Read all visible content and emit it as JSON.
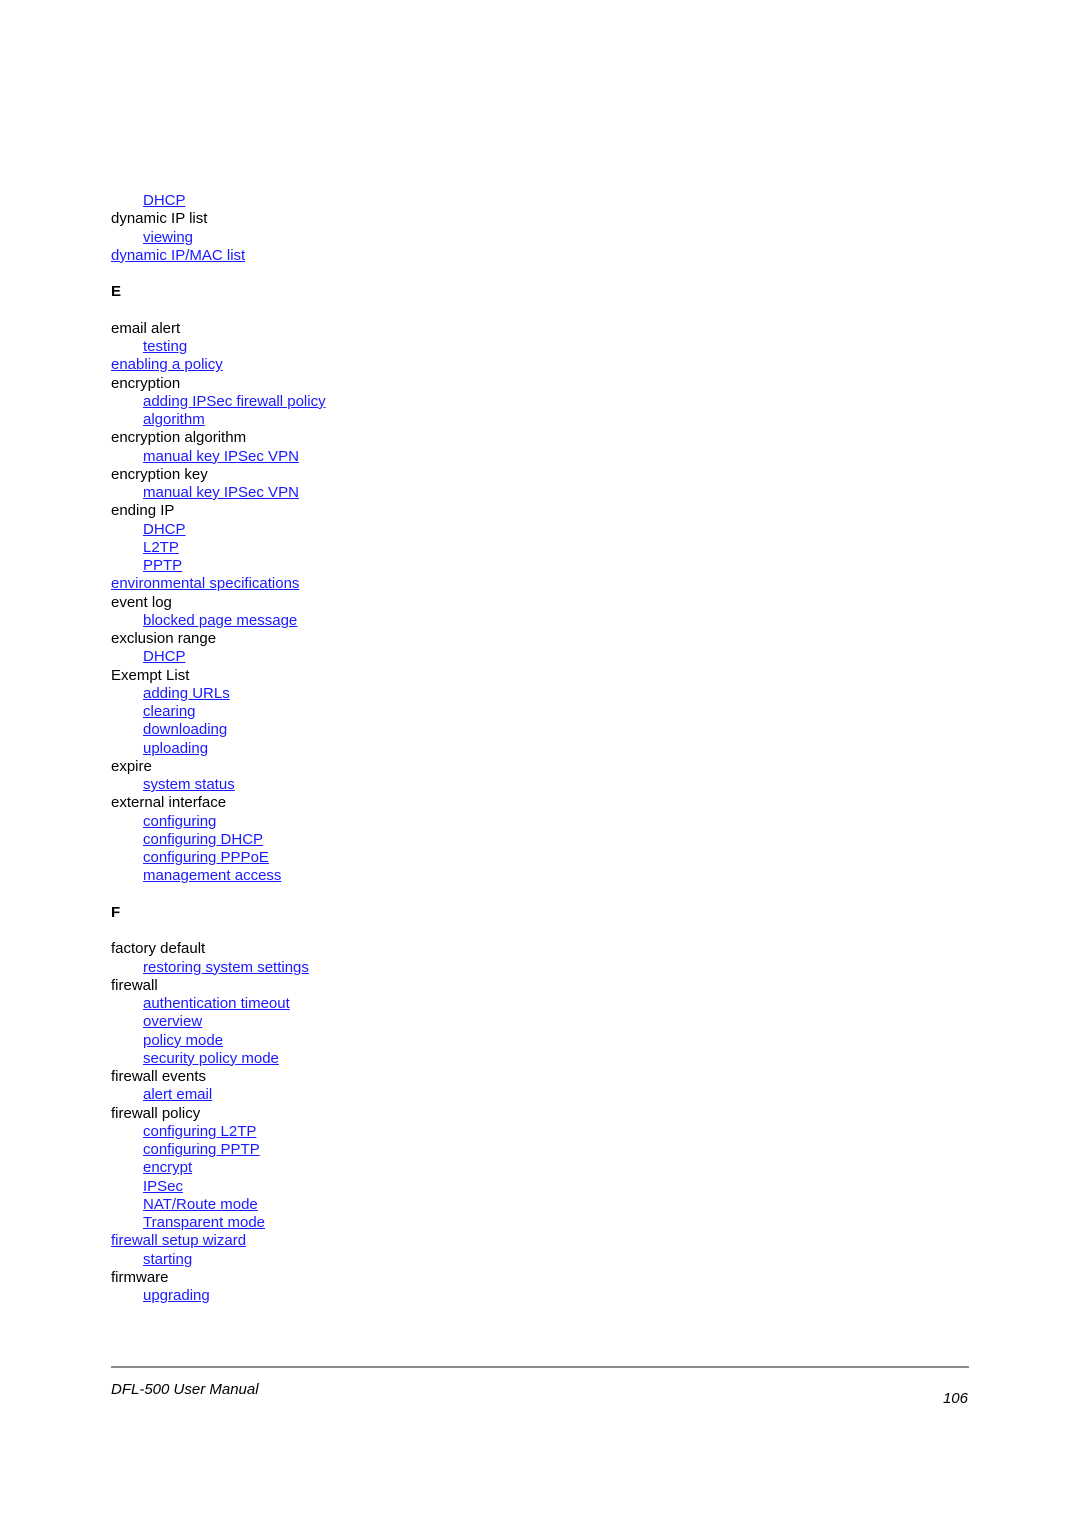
{
  "index": [
    {
      "type": "sub",
      "text": "DHCP",
      "link": true
    },
    {
      "type": "term",
      "text": "dynamic IP list",
      "link": false
    },
    {
      "type": "sub",
      "text": "viewing",
      "link": true
    },
    {
      "type": "term",
      "text": "dynamic IP/MAC list",
      "link": true
    },
    {
      "type": "gap"
    },
    {
      "type": "letter",
      "text": "E"
    },
    {
      "type": "gap"
    },
    {
      "type": "term",
      "text": "email alert",
      "link": false
    },
    {
      "type": "sub",
      "text": "testing",
      "link": true
    },
    {
      "type": "term",
      "text": "enabling a policy",
      "link": true
    },
    {
      "type": "term",
      "text": "encryption",
      "link": false
    },
    {
      "type": "sub",
      "text": "adding IPSec firewall policy",
      "link": true
    },
    {
      "type": "sub",
      "text": "algorithm",
      "link": true
    },
    {
      "type": "term",
      "text": "encryption algorithm",
      "link": false
    },
    {
      "type": "sub",
      "text": "manual key IPSec VPN",
      "link": true
    },
    {
      "type": "term",
      "text": "encryption key",
      "link": false
    },
    {
      "type": "sub",
      "text": "manual key IPSec VPN",
      "link": true
    },
    {
      "type": "term",
      "text": "ending IP",
      "link": false
    },
    {
      "type": "sub",
      "text": "DHCP",
      "link": true
    },
    {
      "type": "sub",
      "text": "L2TP",
      "link": true
    },
    {
      "type": "sub",
      "text": "PPTP",
      "link": true
    },
    {
      "type": "term",
      "text": "environmental specifications",
      "link": true
    },
    {
      "type": "term",
      "text": "event log",
      "link": false
    },
    {
      "type": "sub",
      "text": "blocked page message",
      "link": true
    },
    {
      "type": "term",
      "text": "exclusion range",
      "link": false
    },
    {
      "type": "sub",
      "text": "DHCP",
      "link": true
    },
    {
      "type": "term",
      "text": "Exempt List",
      "link": false
    },
    {
      "type": "sub",
      "text": "adding URLs",
      "link": true
    },
    {
      "type": "sub",
      "text": "clearing",
      "link": true
    },
    {
      "type": "sub",
      "text": "downloading",
      "link": true
    },
    {
      "type": "sub",
      "text": "uploading",
      "link": true
    },
    {
      "type": "term",
      "text": "expire",
      "link": false
    },
    {
      "type": "sub",
      "text": "system status",
      "link": true
    },
    {
      "type": "term",
      "text": "external interface",
      "link": false
    },
    {
      "type": "sub",
      "text": "configuring",
      "link": true
    },
    {
      "type": "sub",
      "text": "configuring DHCP",
      "link": true
    },
    {
      "type": "sub",
      "text": "configuring PPPoE",
      "link": true
    },
    {
      "type": "sub",
      "text": "management access",
      "link": true
    },
    {
      "type": "gap"
    },
    {
      "type": "letter",
      "text": "F"
    },
    {
      "type": "gap"
    },
    {
      "type": "term",
      "text": "factory default",
      "link": false
    },
    {
      "type": "sub",
      "text": "restoring system settings",
      "link": true
    },
    {
      "type": "term",
      "text": "firewall",
      "link": false
    },
    {
      "type": "sub",
      "text": "authentication timeout",
      "link": true
    },
    {
      "type": "sub",
      "text": "overview",
      "link": true
    },
    {
      "type": "sub",
      "text": "policy mode",
      "link": true
    },
    {
      "type": "sub",
      "text": "security policy mode",
      "link": true
    },
    {
      "type": "term",
      "text": "firewall events",
      "link": false
    },
    {
      "type": "sub",
      "text": "alert email",
      "link": true
    },
    {
      "type": "term",
      "text": "firewall policy",
      "link": false
    },
    {
      "type": "sub",
      "text": "configuring L2TP",
      "link": true
    },
    {
      "type": "sub",
      "text": "configuring PPTP",
      "link": true
    },
    {
      "type": "sub",
      "text": "encrypt",
      "link": true
    },
    {
      "type": "sub",
      "text": "IPSec",
      "link": true
    },
    {
      "type": "sub",
      "text": "NAT/Route mode",
      "link": true
    },
    {
      "type": "sub",
      "text": "Transparent mode",
      "link": true
    },
    {
      "type": "term",
      "text": "firewall setup wizard",
      "link": true
    },
    {
      "type": "sub",
      "text": "starting",
      "link": true
    },
    {
      "type": "term",
      "text": "firmware",
      "link": false
    },
    {
      "type": "sub",
      "text": "upgrading",
      "link": true
    }
  ],
  "footer": {
    "title": "DFL-500 User Manual",
    "page_number": "106"
  },
  "colors": {
    "link": "#1a1aff",
    "text": "#000000",
    "rule": "#8a8a8a"
  }
}
